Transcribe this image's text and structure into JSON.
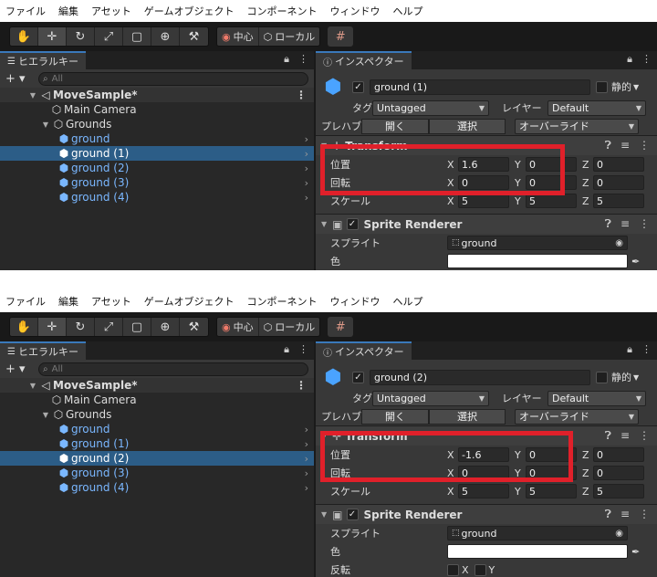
{
  "menu": [
    "ファイル",
    "編集",
    "アセット",
    "ゲームオブジェクト",
    "コンポーネント",
    "ウィンドウ",
    "ヘルプ"
  ],
  "toolbar": {
    "pivot_label": "中心",
    "space_label": "ローカル"
  },
  "hierarchy": {
    "tab_label": "ヒエラルキー",
    "search_placeholder": "All",
    "scene_name": "MoveSample*",
    "main_camera": "Main Camera",
    "grounds": "Grounds",
    "children": [
      "ground",
      "ground (1)",
      "ground (2)",
      "ground (3)",
      "ground (4)"
    ]
  },
  "inspector": {
    "tab_label": "インスペクター",
    "static_label": "静的",
    "tag_label": "タグ",
    "tag_value": "Untagged",
    "layer_label": "レイヤー",
    "layer_value": "Default",
    "prefab_label": "プレハブ",
    "open_label": "開く",
    "select_label": "選択",
    "override_label": "オーバーライド",
    "transform_title": "Transform",
    "position_label": "位置",
    "rotation_label": "回転",
    "scale_label": "スケール",
    "sprite_renderer_title": "Sprite Renderer",
    "sprite_label": "スプライト",
    "sprite_value": "ground",
    "color_label": "色",
    "flip_label": "反転"
  },
  "shots": [
    {
      "selected_index": 1,
      "object_name": "ground (1)",
      "position": {
        "x": "1.6",
        "y": "0",
        "z": "0"
      },
      "rotation": {
        "x": "0",
        "y": "0",
        "z": "0"
      },
      "scale": {
        "x": "5",
        "y": "5",
        "z": "5"
      }
    },
    {
      "selected_index": 2,
      "object_name": "ground (2)",
      "position": {
        "x": "-1.6",
        "y": "0",
        "z": "0"
      },
      "rotation": {
        "x": "0",
        "y": "0",
        "z": "0"
      },
      "scale": {
        "x": "5",
        "y": "5",
        "z": "5"
      }
    }
  ],
  "colors": {
    "highlight": "#e0202a",
    "selection": "#2c5d87",
    "prefab": "#7ab7ff"
  }
}
